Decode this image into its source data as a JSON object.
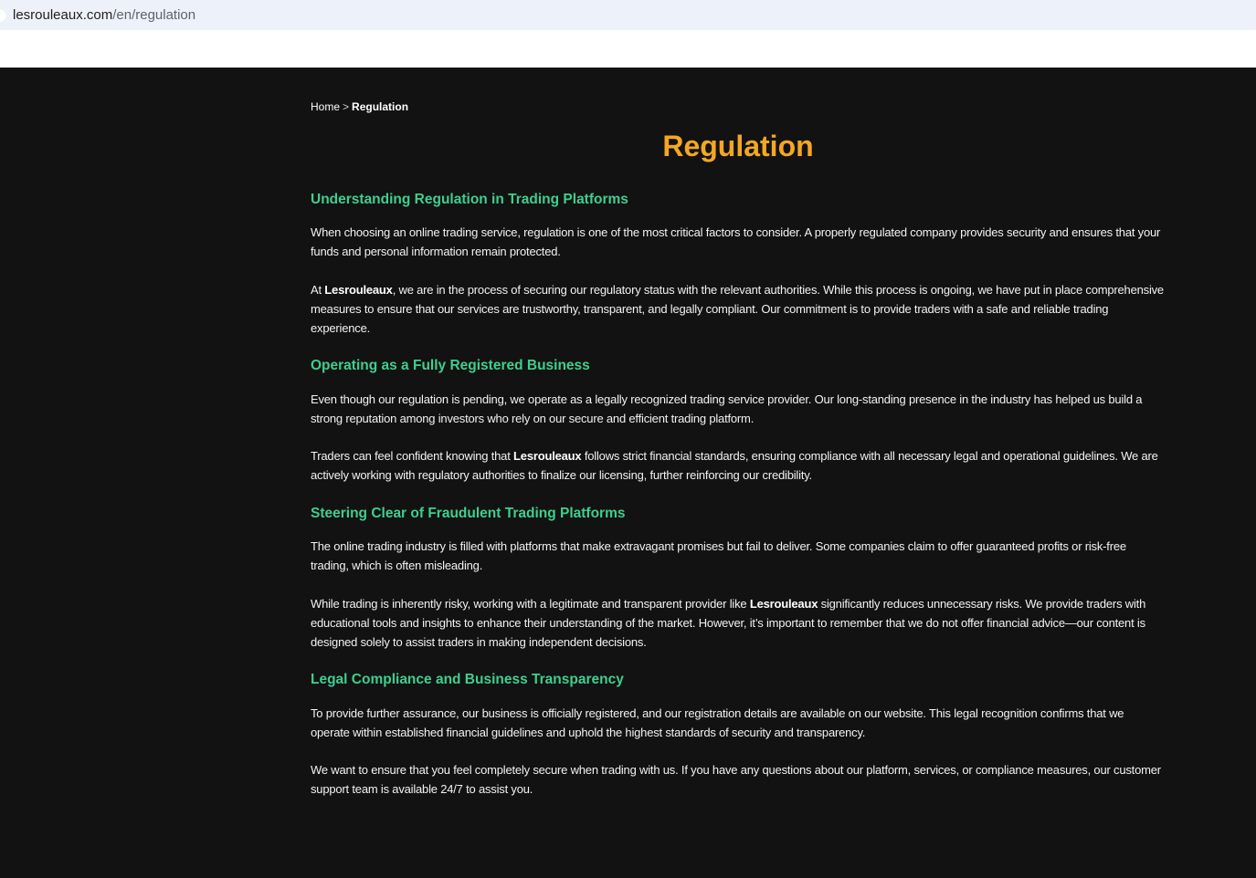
{
  "browser": {
    "url_domain": "lesrouleaux.com",
    "url_path": "/en/regulation"
  },
  "breadcrumb": {
    "home": "Home",
    "separator": ">",
    "current": "Regulation"
  },
  "page_title": "Regulation",
  "colors": {
    "title": "#f5a623",
    "section_heading": "#3ecf8e",
    "background": "#121212",
    "text": "#f2f2f2"
  },
  "brand": "Lesrouleaux",
  "sections": [
    {
      "heading": "Understanding Regulation in Trading Platforms",
      "p1": "When choosing an online trading service, regulation is one of the most critical factors to consider. A properly regulated company provides security and ensures that your funds and personal information remain protected.",
      "p2_before": "At ",
      "p2_after": ", we are in the process of securing our regulatory status with the relevant authorities. While this process is ongoing, we have put in place comprehensive measures to ensure that our services are trustworthy, transparent, and legally compliant. Our commitment is to provide traders with a safe and reliable trading experience."
    },
    {
      "heading": "Operating as a Fully Registered Business",
      "p1": "Even though our regulation is pending, we operate as a legally recognized trading service provider. Our long-standing presence in the industry has helped us build a strong reputation among investors who rely on our secure and efficient trading platform.",
      "p2_before": "Traders can feel confident knowing that ",
      "p2_after": " follows strict financial standards, ensuring compliance with all necessary legal and operational guidelines. We are actively working with regulatory authorities to finalize our licensing, further reinforcing our credibility."
    },
    {
      "heading": "Steering Clear of Fraudulent Trading Platforms",
      "p1": "The online trading industry is filled with platforms that make extravagant promises but fail to deliver. Some companies claim to offer guaranteed profits or risk-free trading, which is often misleading.",
      "p2_before": "While trading is inherently risky, working with a legitimate and transparent provider like ",
      "p2_after": " significantly reduces unnecessary risks. We provide traders with educational tools and insights to enhance their understanding of the market. However, it’s important to remember that we do not offer financial advice—our content is designed solely to assist traders in making independent decisions."
    },
    {
      "heading": "Legal Compliance and Business Transparency",
      "p1": "To provide further assurance, our business is officially registered, and our registration details are available on our website. This legal recognition confirms that we operate within established financial guidelines and uphold the highest standards of security and transparency.",
      "p2": "We want to ensure that you feel completely secure when trading with us. If you have any questions about our platform, services, or compliance measures, our customer support team is available 24/7 to assist you."
    }
  ]
}
